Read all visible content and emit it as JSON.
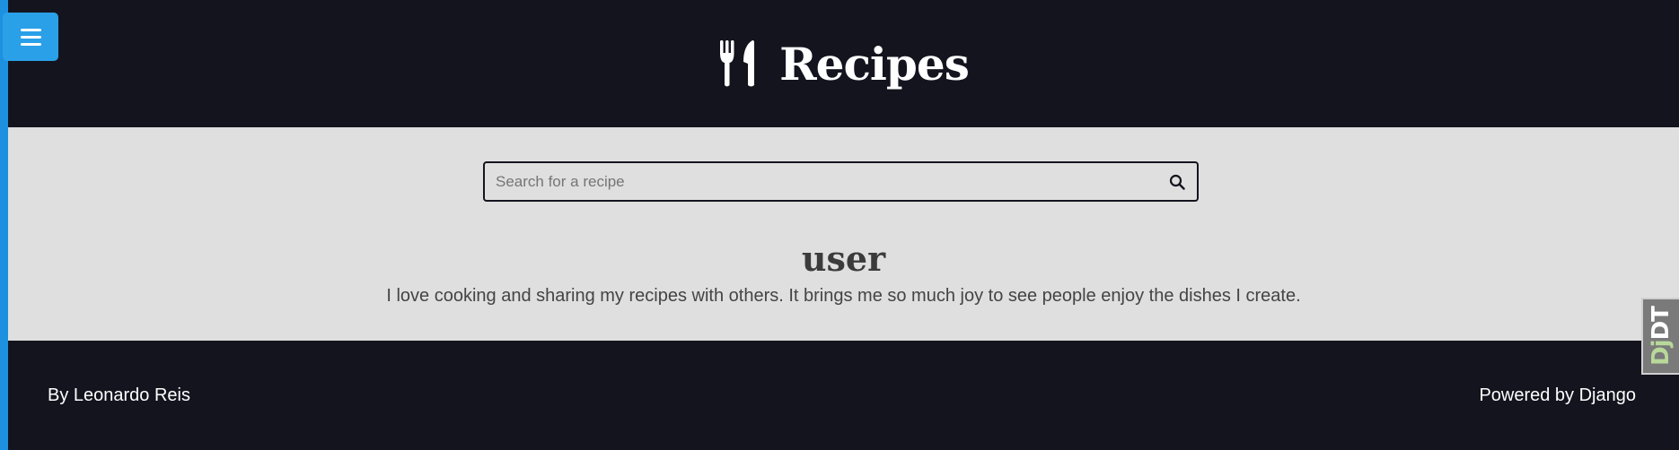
{
  "header": {
    "title": "Recipes",
    "logo_icon": "utensils-icon"
  },
  "menu": {
    "icon": "hamburger-menu-icon"
  },
  "search": {
    "placeholder": "Search for a recipe",
    "value": "",
    "icon": "search-icon"
  },
  "profile": {
    "username": "user",
    "bio": "I love cooking and sharing my recipes with others. It brings me so much joy to see people enjoy the dishes I create."
  },
  "footer": {
    "left_text": "By Leonardo Reis",
    "right_text": "Powered by Django"
  },
  "debug_toolbar": {
    "prefix": "Dj",
    "suffix": "DT"
  },
  "colors": {
    "dark_bg": "#14141f",
    "content_bg": "#dfdfdf",
    "accent": "#2aa0e8"
  }
}
